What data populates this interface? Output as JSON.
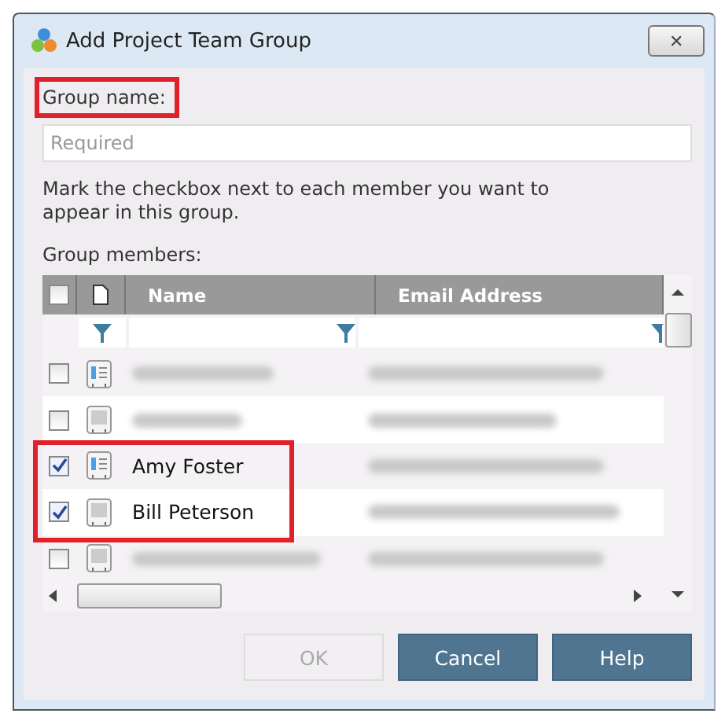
{
  "window": {
    "title": "Add Project Team Group",
    "close": "✕"
  },
  "group_name": {
    "label": "Group name:",
    "highlighted": true,
    "placeholder": "Required"
  },
  "instructions": "Mark the checkbox next to each member you want to appear in this group.",
  "members_label": "Group members:",
  "table": {
    "columns": [
      "Name",
      "Email Address"
    ],
    "all_checked": false,
    "rows": [
      {
        "checked": false,
        "kind": "card",
        "highlighted": false
      },
      {
        "checked": false,
        "kind": "plain",
        "highlighted": false
      },
      {
        "checked": true,
        "kind": "card",
        "name": "Amy Foster",
        "highlighted": true
      },
      {
        "checked": true,
        "kind": "plain",
        "name": "Bill Peterson",
        "highlighted": true
      },
      {
        "checked": false,
        "kind": "plain",
        "highlighted": false
      }
    ]
  },
  "buttons": [
    {
      "label": "OK",
      "disabled": true
    },
    {
      "label": "Cancel",
      "disabled": false
    },
    {
      "label": "Help",
      "disabled": false
    }
  ]
}
